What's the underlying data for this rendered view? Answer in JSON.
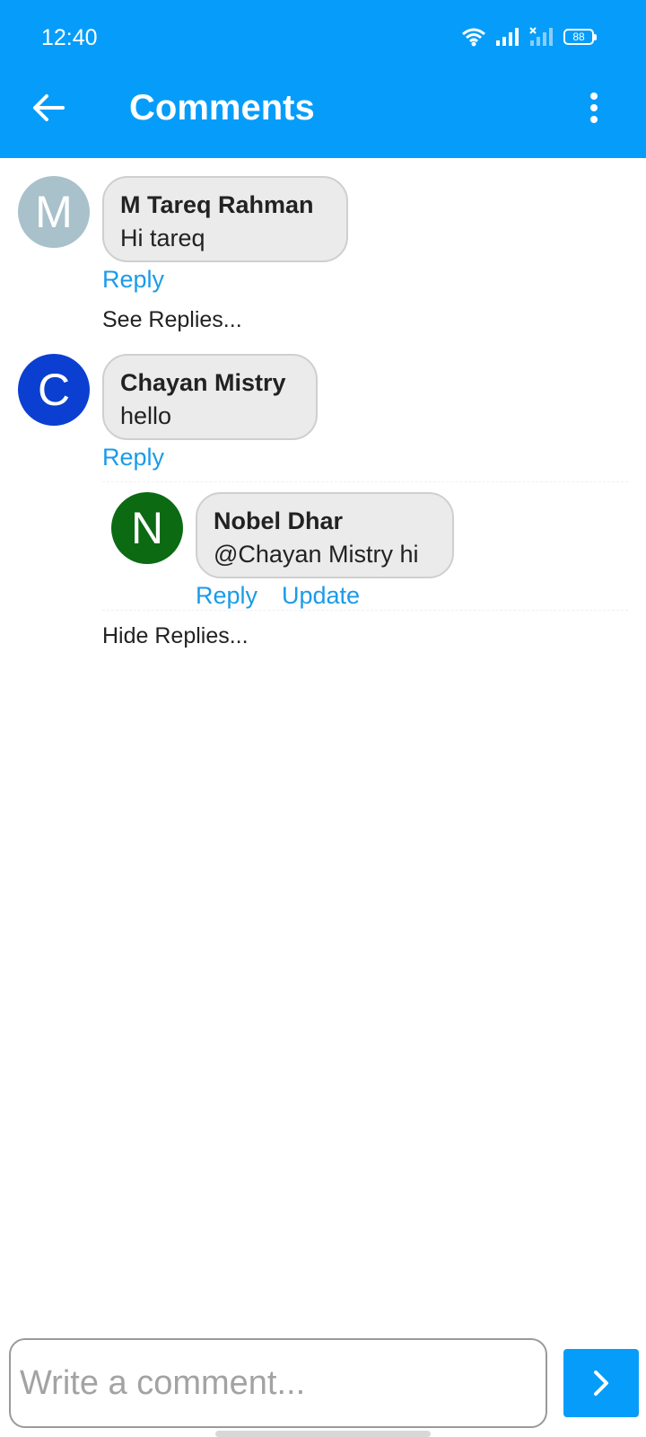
{
  "status_bar": {
    "time": "12:40",
    "battery": "88"
  },
  "header": {
    "title": "Comments",
    "back_icon": "arrow-left-icon",
    "more_icon": "more-vertical-icon",
    "background": "#069dfa"
  },
  "comments": [
    {
      "initial": "M",
      "avatar_color": "#a8c1cb",
      "author": "M Tareq Rahman",
      "text": "Hi tareq",
      "reply_label": "Reply",
      "replies_toggle": "See Replies..."
    },
    {
      "initial": "C",
      "avatar_color": "#0b3fd1",
      "author": "Chayan Mistry",
      "text": "hello",
      "reply_label": "Reply",
      "replies_toggle": "Hide Replies...",
      "replies": [
        {
          "initial": "N",
          "avatar_color": "#0b6a12",
          "author": "Nobel Dhar",
          "text": "@Chayan Mistry hi",
          "reply_label": "Reply",
          "update_label": "Update"
        }
      ]
    }
  ],
  "composer": {
    "placeholder": "Write a comment...",
    "send_icon": "chevron-right-icon"
  },
  "colors": {
    "accent": "#069dfa",
    "link": "#1a9be8",
    "bubble": "#ebebeb"
  }
}
